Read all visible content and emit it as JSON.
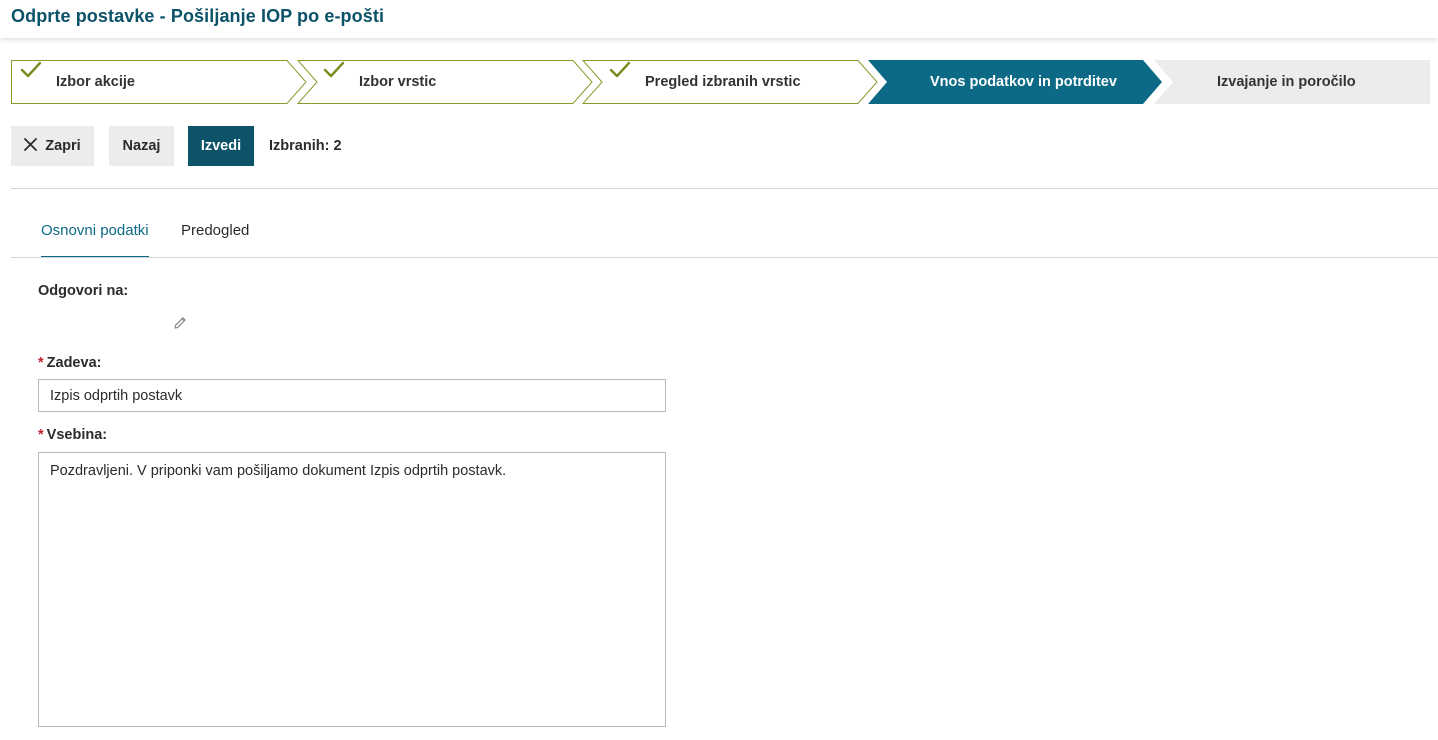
{
  "header": {
    "title": "Odprte postavke - Pošiljanje IOP po e-pošti"
  },
  "wizard": {
    "steps": [
      {
        "label": "Izbor akcije",
        "status": "completed"
      },
      {
        "label": "Izbor vrstic",
        "status": "completed"
      },
      {
        "label": "Pregled izbranih vrstic",
        "status": "completed"
      },
      {
        "label": "Vnos podatkov in potrditev",
        "status": "active"
      },
      {
        "label": "Izvajanje in poročilo",
        "status": "pending"
      }
    ],
    "colors": {
      "completed_border": "#8a9a2a",
      "check": "#7a8c1f",
      "active_fill": "#0c6a86",
      "pending_fill": "#ececec"
    }
  },
  "toolbar": {
    "close_label": "Zapri",
    "back_label": "Nazaj",
    "execute_label": "Izvedi",
    "selected_text": "Izbranih: 2"
  },
  "tabs": [
    {
      "label": "Osnovni podatki",
      "active": true
    },
    {
      "label": "Predogled",
      "active": false
    }
  ],
  "form": {
    "reply_to_label": "Odgovori na:",
    "subject_label": "Zadeva:",
    "subject_value": "Izpis odprtih postavk",
    "content_label": "Vsebina:",
    "content_value": "Pozdravljeni. V priponki vam pošiljamo dokument Izpis odprtih postavk.",
    "required_mark": "*"
  },
  "icons": {
    "close": "close-icon",
    "check": "check-icon",
    "edit": "pencil-icon"
  }
}
